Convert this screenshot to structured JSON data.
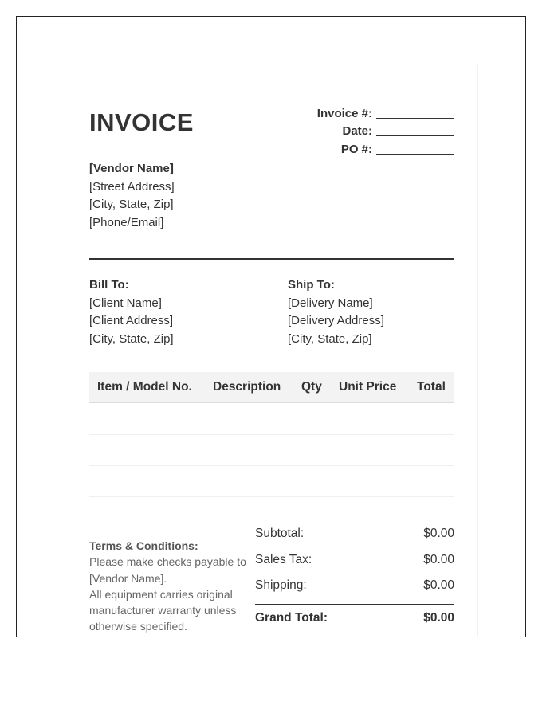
{
  "header": {
    "title": "INVOICE",
    "invoice_label": "Invoice #:",
    "date_label": "Date:",
    "po_label": "PO #:"
  },
  "vendor": {
    "name": "[Vendor Name]",
    "street": "[Street Address]",
    "city": "[City, State, Zip]",
    "contact": "[Phone/Email]"
  },
  "bill_to": {
    "heading": "Bill To:",
    "name": "[Client Name]",
    "address": "[Client Address]",
    "city": "[City, State, Zip]"
  },
  "ship_to": {
    "heading": "Ship To:",
    "name": "[Delivery Name]",
    "address": "[Delivery Address]",
    "city": "[City, State, Zip]"
  },
  "table": {
    "columns": [
      "Item / Model No.",
      "Description",
      "Qty",
      "Unit Price",
      "Total"
    ]
  },
  "terms": {
    "heading": "Terms & Conditions:",
    "line1": "Please make checks payable to [Vendor Name].",
    "line2": "All equipment carries original manufacturer warranty unless otherwise specified."
  },
  "totals": {
    "subtotal_label": "Subtotal:",
    "subtotal_value": "$0.00",
    "tax_label": "Sales Tax:",
    "tax_value": "$0.00",
    "shipping_label": "Shipping:",
    "shipping_value": "$0.00",
    "grand_label": "Grand Total:",
    "grand_value": "$0.00"
  }
}
